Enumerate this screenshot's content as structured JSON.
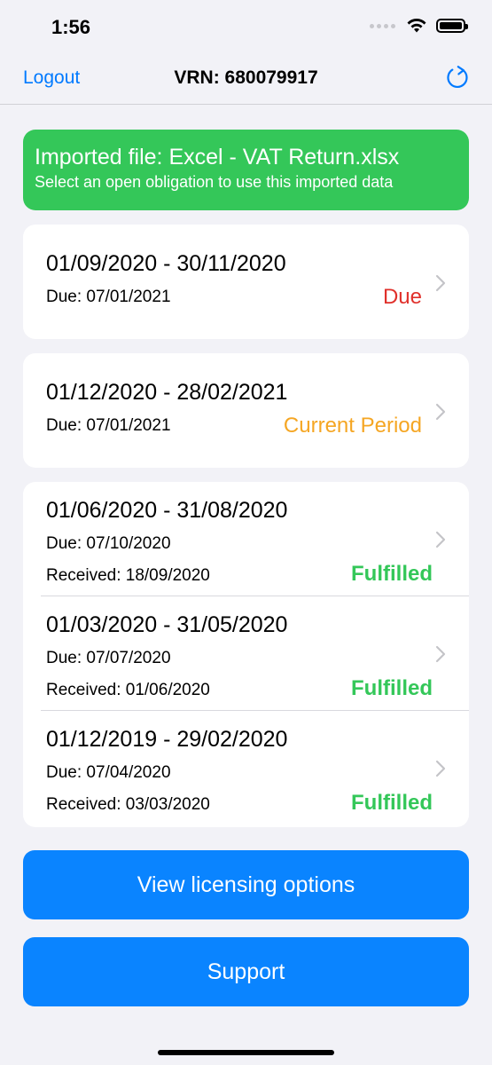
{
  "status_bar": {
    "time": "1:56"
  },
  "nav": {
    "left": "Logout",
    "title": "VRN: 680079917",
    "refresh_icon": "refresh-icon"
  },
  "banner": {
    "title": "Imported file: Excel - VAT Return.xlsx",
    "subtitle": "Select an open obligation to use this imported data"
  },
  "open_obligations": [
    {
      "period": "01/09/2020 - 30/11/2020",
      "due": "Due: 07/01/2021",
      "status": "Due",
      "status_color": "#e0302b"
    },
    {
      "period": "01/12/2020 - 28/02/2021",
      "due": "Due: 07/01/2021",
      "status": "Current Period",
      "status_color": "#f5a623"
    }
  ],
  "fulfilled_obligations": [
    {
      "period": "01/06/2020 - 31/08/2020",
      "due": "Due: 07/10/2020",
      "received": "Received: 18/09/2020",
      "status": "Fulfilled"
    },
    {
      "period": "01/03/2020 - 31/05/2020",
      "due": "Due: 07/07/2020",
      "received": "Received: 01/06/2020",
      "status": "Fulfilled"
    },
    {
      "period": "01/12/2019 - 29/02/2020",
      "due": "Due: 07/04/2020",
      "received": "Received: 03/03/2020",
      "status": "Fulfilled"
    }
  ],
  "fulfilled_color": "#34c759",
  "buttons": {
    "licensing": "View licensing options",
    "support": "Support"
  }
}
